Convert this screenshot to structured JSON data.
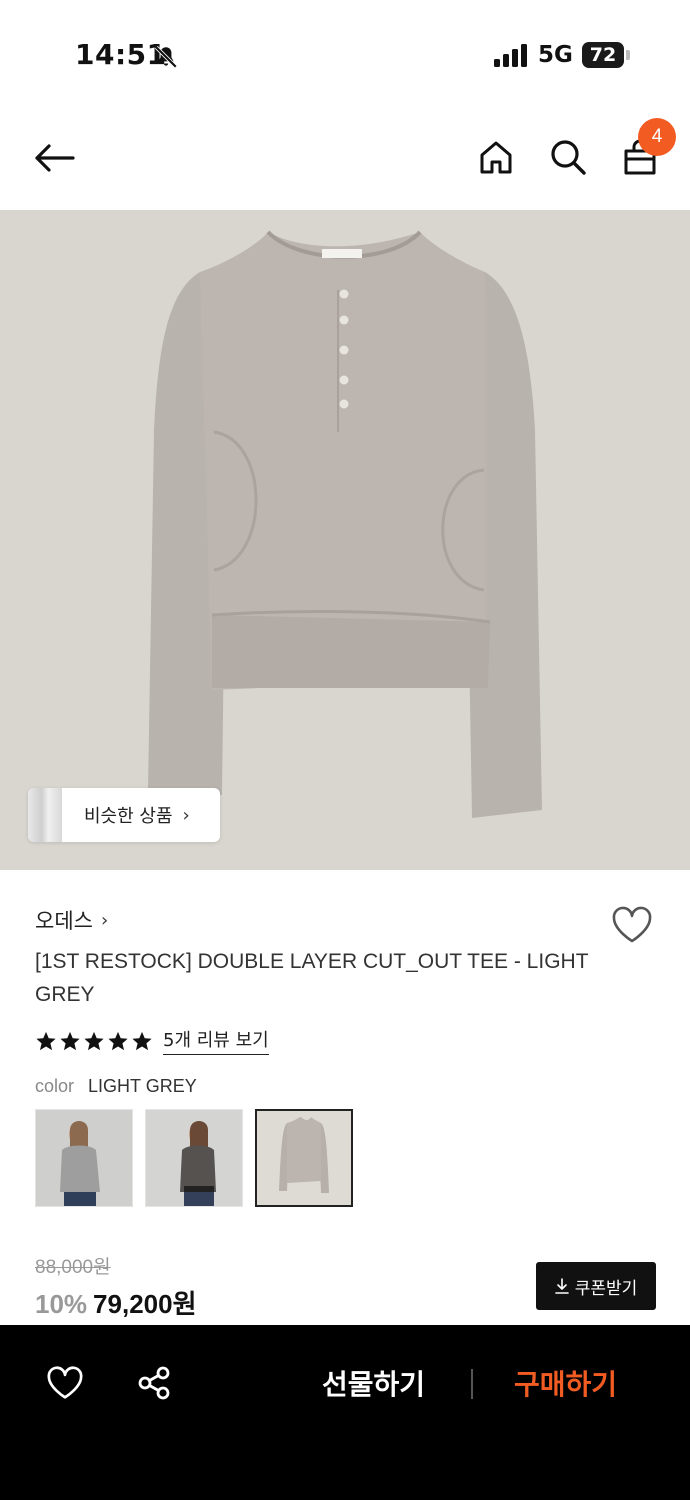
{
  "status_bar": {
    "time": "14:51",
    "network": "5G",
    "battery": "72"
  },
  "header": {
    "cart_count": "4",
    "icons": [
      "back-arrow-icon",
      "home-icon",
      "search-icon",
      "shopping-bag-icon"
    ]
  },
  "product": {
    "similar_label": "비슷한 상품",
    "similar_chevron": "›",
    "brand": "오데스",
    "brand_chevron": "›",
    "title": "[1ST RESTOCK] DOUBLE LAYER CUT_OUT TEE - LIGHT GREY",
    "rating_stars": 5,
    "review_link": "5개 리뷰 보기",
    "color_label": "color",
    "color_value": "LIGHT GREY",
    "swatches": [
      "model-light-grey",
      "model-charcoal",
      "flat-light-grey"
    ],
    "selected_swatch": 2,
    "original_price": "88,000원",
    "discount": "10%",
    "sale_price": "79,200원",
    "coupon_label": "쿠폰받기"
  },
  "colors": {
    "accent": "#f25c22",
    "bottom_bar": "#000000",
    "image_bg": "#d9d6d0"
  },
  "bottom_bar": {
    "gift_label": "선물하기",
    "buy_label": "구매하기"
  }
}
